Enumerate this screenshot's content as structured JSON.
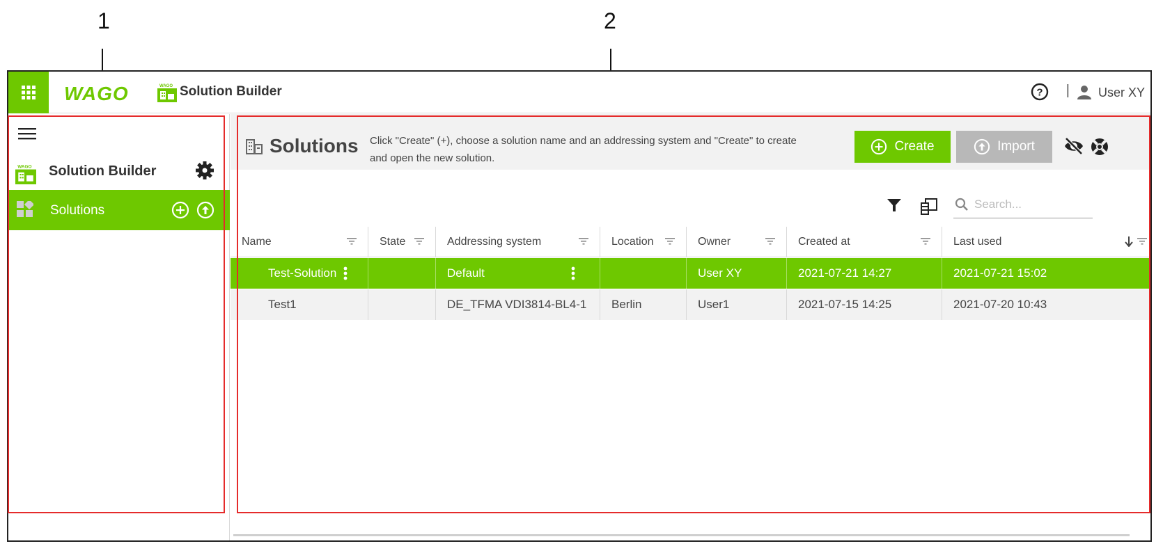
{
  "callouts": {
    "one": "1",
    "two": "2"
  },
  "topbar": {
    "brand": "WAGO",
    "app_title": "Solution Builder",
    "user_name": "User XY",
    "separator": "|",
    "brand_color": "#6ec800"
  },
  "sidebar": {
    "app_name": "Solution Builder",
    "item_solutions": "Solutions"
  },
  "main": {
    "title": "Solutions",
    "hint_line1": "Click \"Create\" (+), choose a solution name and an addressing system and \"Create\" to create",
    "hint_line2": "and open the new solution.",
    "create_label": "Create",
    "import_label": "Import",
    "search_placeholder": "Search..."
  },
  "table": {
    "columns": [
      "Name",
      "State",
      "Addressing system",
      "Location",
      "Owner",
      "Created at",
      "Last used"
    ],
    "rows": [
      [
        "Test-Solution",
        "",
        "Default",
        "",
        "User XY",
        "2021-07-21 14:27",
        "2021-07-21 15:02"
      ],
      [
        "Test1",
        "",
        "DE_TFMA VDI3814-BL4-1",
        "Berlin",
        "User1",
        "2021-07-15 14:25",
        "2021-07-20 10:43"
      ]
    ],
    "selected_row": 0
  }
}
